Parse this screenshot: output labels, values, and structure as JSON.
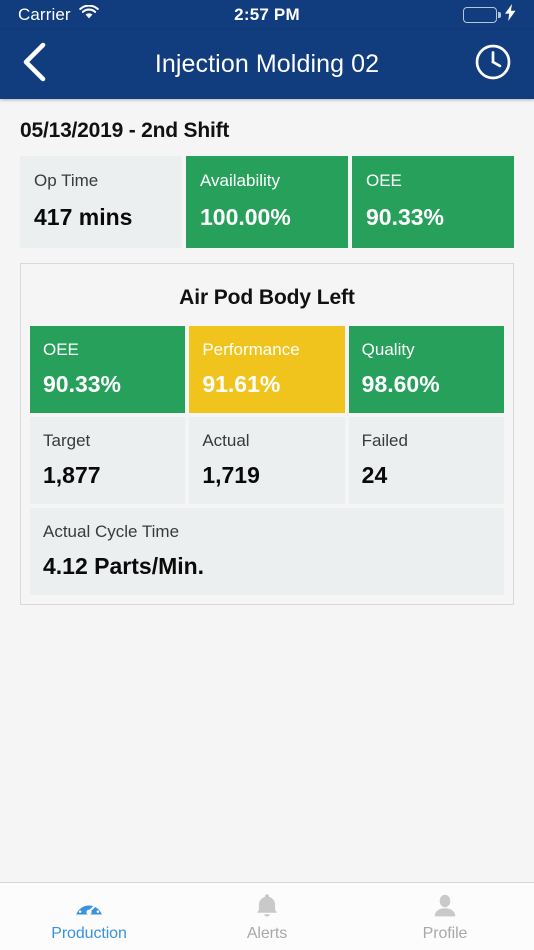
{
  "status_bar": {
    "carrier": "Carrier",
    "wifi_icon": "wifi-icon",
    "time": "2:57 PM",
    "battery_icon": "battery-full-icon",
    "charging_icon": "lightning-bolt-icon"
  },
  "nav_bar": {
    "back_icon": "chevron-left-icon",
    "title": "Injection Molding 02",
    "clock_icon": "clock-icon"
  },
  "theme": {
    "navy": "#113c7e",
    "green": "#26a05b",
    "yellow": "#f0c41c",
    "neutral_tile": "#eceff0",
    "page_bg": "#f5f5f5",
    "accent_blue": "#3a92e0",
    "inactive_gray": "#a9a9a9"
  },
  "main": {
    "shift_title": "05/13/2019 - 2nd Shift",
    "summary_tiles": [
      {
        "label": "Op Time",
        "value": "417 mins",
        "style": "neutral"
      },
      {
        "label": "Availability",
        "value": "100.00%",
        "style": "green"
      },
      {
        "label": "OEE",
        "value": "90.33%",
        "style": "green"
      }
    ],
    "product_card": {
      "title": "Air Pod Body Left",
      "kpi_tiles": [
        {
          "label": "OEE",
          "value": "90.33%",
          "style": "green"
        },
        {
          "label": "Performance",
          "value": "91.61%",
          "style": "yellow"
        },
        {
          "label": "Quality",
          "value": "98.60%",
          "style": "green"
        }
      ],
      "count_tiles": [
        {
          "label": "Target",
          "value": "1,877",
          "style": "neutral"
        },
        {
          "label": "Actual",
          "value": "1,719",
          "style": "neutral"
        },
        {
          "label": "Failed",
          "value": "24",
          "style": "neutral"
        }
      ],
      "cycle_time": {
        "label": "Actual Cycle Time",
        "value": "4.12 Parts/Min.",
        "style": "neutral"
      }
    }
  },
  "tab_bar": {
    "items": [
      {
        "label": "Production",
        "icon": "gauge-icon",
        "active": true
      },
      {
        "label": "Alerts",
        "icon": "bell-icon",
        "active": false
      },
      {
        "label": "Profile",
        "icon": "person-icon",
        "active": false
      }
    ]
  }
}
